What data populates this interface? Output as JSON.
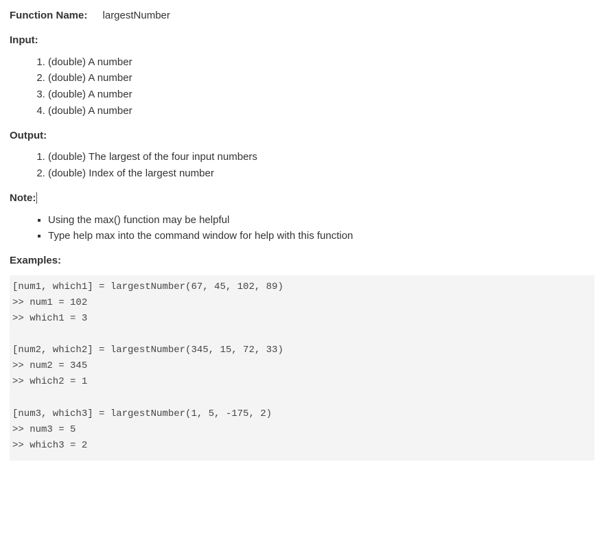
{
  "labels": {
    "function_name": "Function Name:",
    "input": "Input:",
    "output": "Output:",
    "note": "Note:",
    "examples": "Examples:"
  },
  "function_name": "largestNumber",
  "inputs": [
    "(double) A number",
    "(double) A number",
    "(double) A number",
    "(double) A number"
  ],
  "outputs": [
    "(double) The largest of the four input numbers",
    "(double) Index of the largest number"
  ],
  "notes": [
    "Using the max() function may be helpful",
    "Type help max into the command window for help with this function"
  ],
  "examples_code": "[num1, which1] = largestNumber(67, 45, 102, 89)\n>> num1 = 102\n>> which1 = 3\n\n[num2, which2] = largestNumber(345, 15, 72, 33)\n>> num2 = 345\n>> which2 = 1\n\n[num3, which3] = largestNumber(1, 5, -175, 2)\n>> num3 = 5\n>> which3 = 2"
}
